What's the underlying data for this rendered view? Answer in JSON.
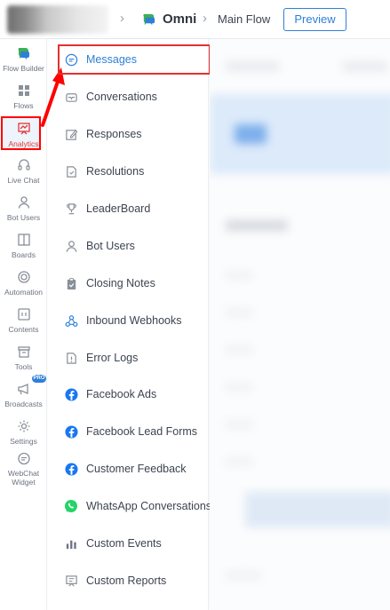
{
  "header": {
    "project_name": "Omni",
    "flow_name": "Main Flow",
    "preview_label": "Preview"
  },
  "colors": {
    "accent": "#2f7fd8",
    "highlight_red": "#e53030",
    "omni_green": "#3cb054"
  },
  "rail": {
    "items": [
      {
        "label": "Flow Builder",
        "icon": "flow-builder-icon"
      },
      {
        "label": "Flows",
        "icon": "flows-grid-icon"
      },
      {
        "label": "Analytics",
        "icon": "analytics-icon",
        "active": true
      },
      {
        "label": "Live Chat",
        "icon": "headset-icon"
      },
      {
        "label": "Bot Users",
        "icon": "user-icon"
      },
      {
        "label": "Boards",
        "icon": "board-icon"
      },
      {
        "label": "Automation",
        "icon": "automation-icon"
      },
      {
        "label": "Contents",
        "icon": "contents-icon"
      },
      {
        "label": "Tools",
        "icon": "tools-icon"
      },
      {
        "label": "Broadcasts",
        "icon": "megaphone-icon",
        "badge": "PRO"
      },
      {
        "label": "Settings",
        "icon": "gear-icon"
      },
      {
        "label": "WebChat",
        "label2": "Widget",
        "icon": "webchat-icon"
      }
    ]
  },
  "analytics_menu": {
    "items": [
      {
        "label": "Messages",
        "icon": "message-icon",
        "active": true
      },
      {
        "label": "Conversations",
        "icon": "conversations-icon"
      },
      {
        "label": "Responses",
        "icon": "edit-icon"
      },
      {
        "label": "Resolutions",
        "icon": "resolution-icon"
      },
      {
        "label": "LeaderBoard",
        "icon": "trophy-icon"
      },
      {
        "label": "Bot Users",
        "icon": "user-icon"
      },
      {
        "label": "Closing Notes",
        "icon": "clipboard-icon"
      },
      {
        "label": "Inbound Webhooks",
        "icon": "webhook-icon"
      },
      {
        "label": "Error Logs",
        "icon": "error-log-icon"
      },
      {
        "label": "Facebook Ads",
        "icon": "facebook-icon"
      },
      {
        "label": "Facebook Lead Forms",
        "icon": "facebook-icon"
      },
      {
        "label": "Customer Feedback",
        "icon": "facebook-icon"
      },
      {
        "label": "WhatsApp Conversations",
        "icon": "whatsapp-icon"
      },
      {
        "label": "Custom Events",
        "icon": "bar-chart-icon"
      },
      {
        "label": "Custom Reports",
        "icon": "report-icon"
      }
    ]
  }
}
